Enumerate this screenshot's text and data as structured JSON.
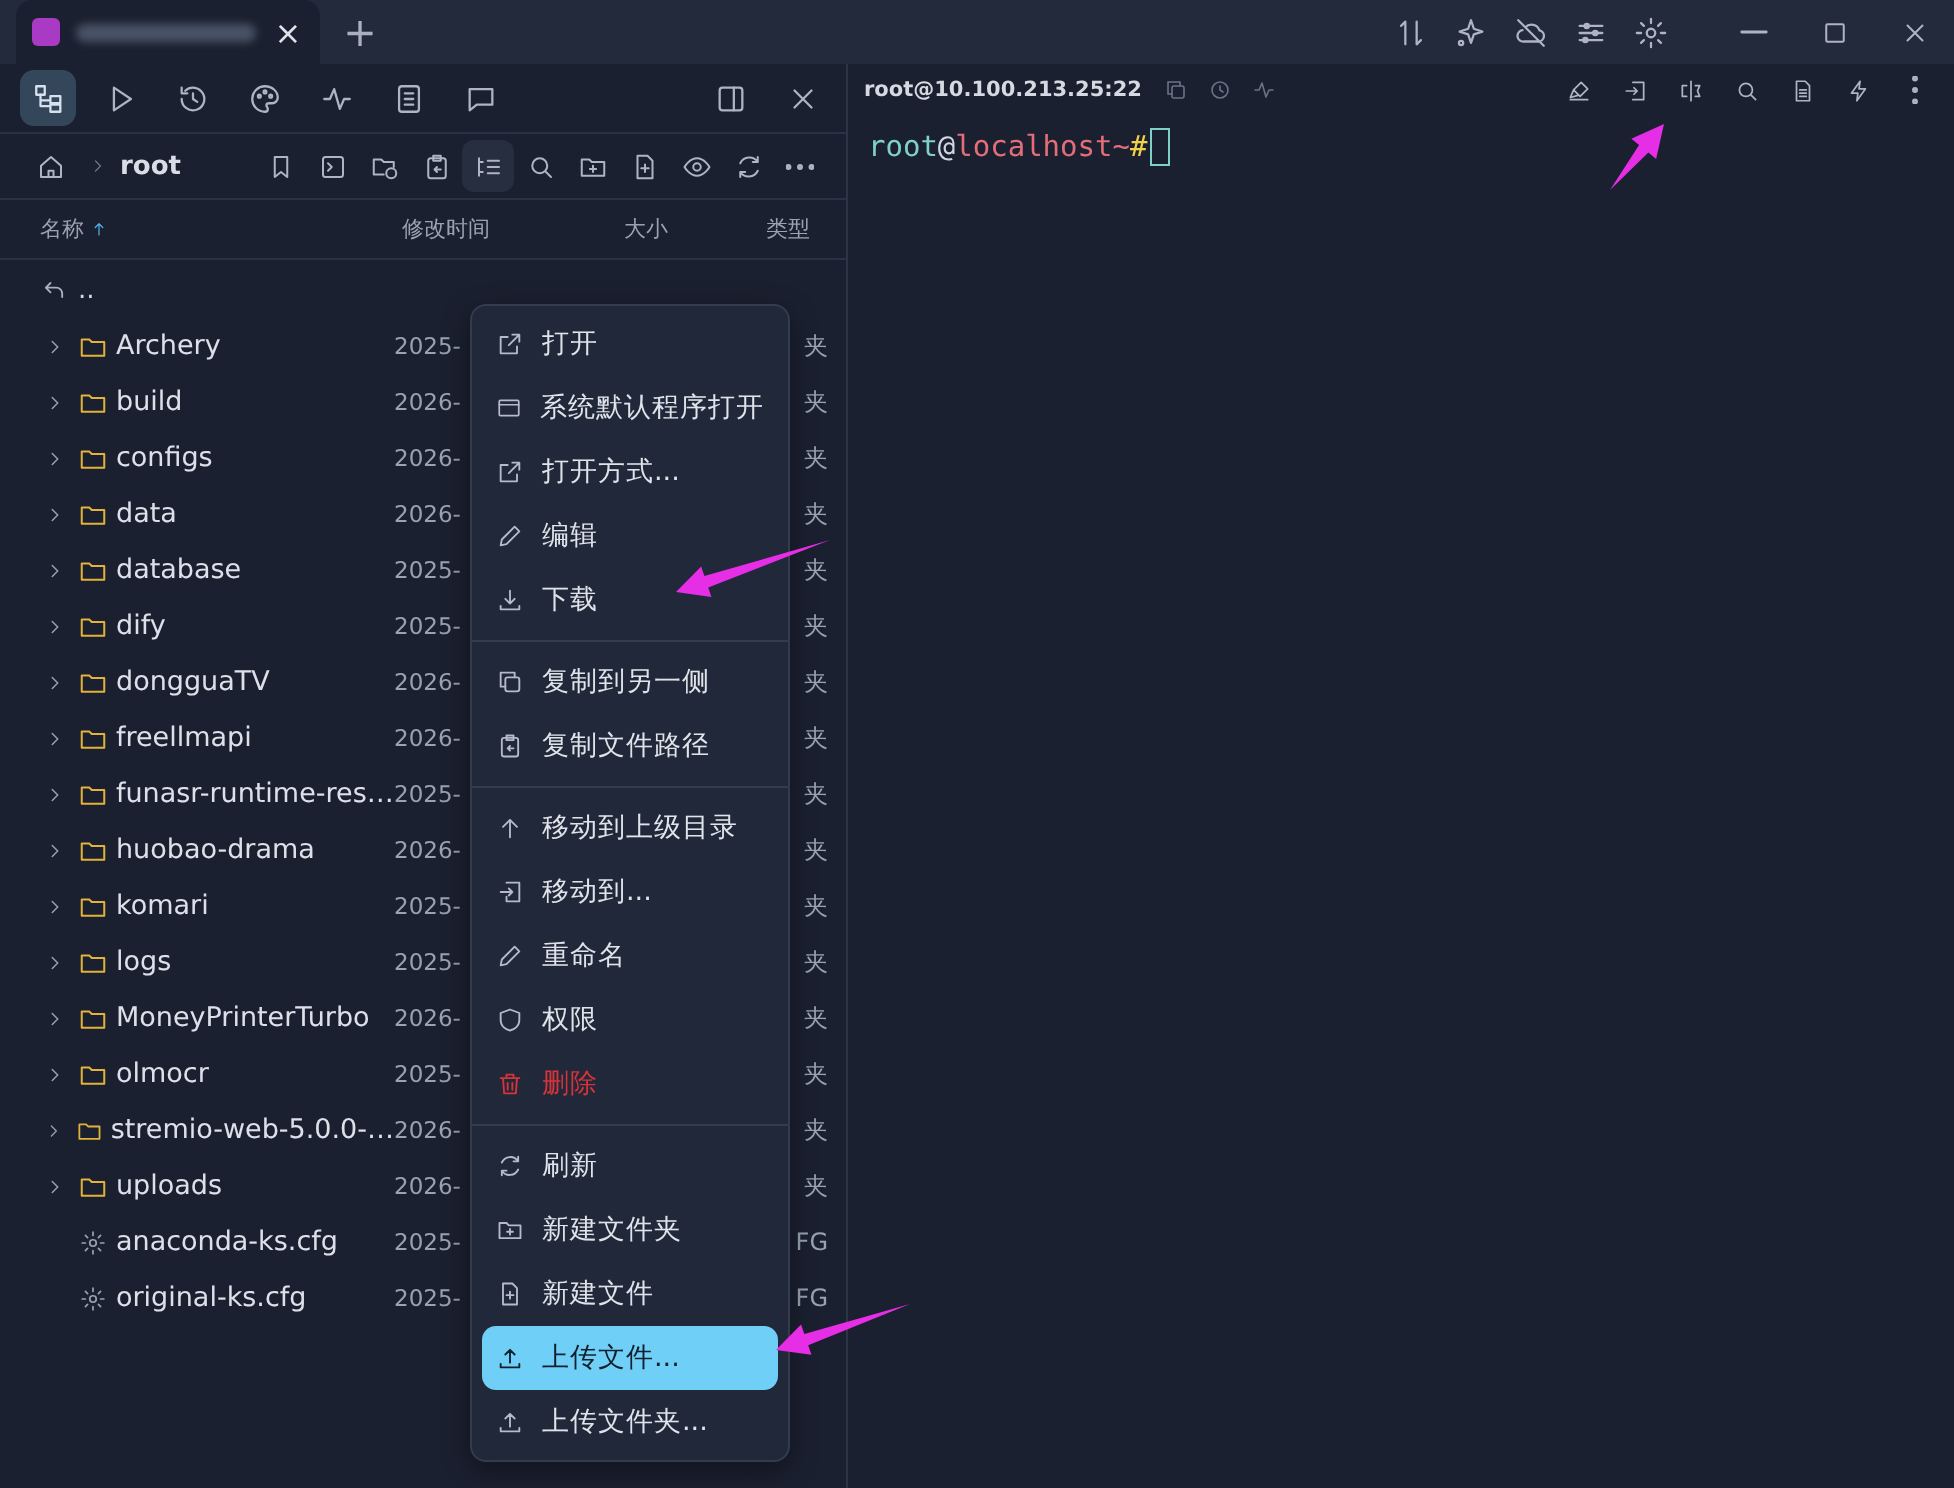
{
  "title_bar": {
    "tab": {
      "close": "×"
    },
    "new_tab": "+"
  },
  "sidebar_tabs": [
    {
      "selected": true
    },
    {
      "selected": false
    },
    {
      "selected": false
    },
    {
      "selected": false
    },
    {
      "selected": false
    },
    {
      "selected": false
    },
    {
      "selected": false
    }
  ],
  "breadcrumb": {
    "path": "root"
  },
  "table": {
    "columns": [
      {
        "label": "名称",
        "sorted": true
      },
      {
        "label": "修改时间",
        "sorted": false
      },
      {
        "label": "大小",
        "sorted": false
      },
      {
        "label": "类型",
        "sorted": false
      }
    ],
    "parent_row": "..",
    "rows": [
      {
        "kind": "folder",
        "name": "Archery",
        "modified": "2025-",
        "type": "夹"
      },
      {
        "kind": "folder",
        "name": "build",
        "modified": "2026-",
        "type": "夹"
      },
      {
        "kind": "folder",
        "name": "configs",
        "modified": "2026-",
        "type": "夹"
      },
      {
        "kind": "folder",
        "name": "data",
        "modified": "2026-",
        "type": "夹"
      },
      {
        "kind": "folder",
        "name": "database",
        "modified": "2025-",
        "type": "夹"
      },
      {
        "kind": "folder",
        "name": "dify",
        "modified": "2025-",
        "type": "夹"
      },
      {
        "kind": "folder",
        "name": "dongguaTV",
        "modified": "2026-",
        "type": "夹"
      },
      {
        "kind": "folder",
        "name": "freellmapi",
        "modified": "2026-",
        "type": "夹"
      },
      {
        "kind": "folder",
        "name": "funasr-runtime-res…",
        "modified": "2025-",
        "type": "夹"
      },
      {
        "kind": "folder",
        "name": "huobao-drama",
        "modified": "2026-",
        "type": "夹"
      },
      {
        "kind": "folder",
        "name": "komari",
        "modified": "2025-",
        "type": "夹"
      },
      {
        "kind": "folder",
        "name": "logs",
        "modified": "2025-",
        "type": "夹"
      },
      {
        "kind": "folder",
        "name": "MoneyPrinterTurbo",
        "modified": "2026-",
        "type": "夹"
      },
      {
        "kind": "folder",
        "name": "olmocr",
        "modified": "2025-",
        "type": "夹"
      },
      {
        "kind": "folder",
        "name": "stremio-web-5.0.0-…",
        "modified": "2026-",
        "type": "夹"
      },
      {
        "kind": "folder",
        "name": "uploads",
        "modified": "2026-",
        "type": "夹"
      },
      {
        "kind": "file",
        "name": "anaconda-ks.cfg",
        "modified": "2025-",
        "type": "FG"
      },
      {
        "kind": "file",
        "name": "original-ks.cfg",
        "modified": "2025-",
        "type": "FG"
      }
    ]
  },
  "context_menu": {
    "groups": [
      [
        {
          "label": "打开",
          "selected": false,
          "danger": false
        },
        {
          "label": "系统默认程序打开",
          "selected": false,
          "danger": false
        },
        {
          "label": "打开方式...",
          "selected": false,
          "danger": false
        },
        {
          "label": "编辑",
          "selected": false,
          "danger": false
        },
        {
          "label": "下载",
          "selected": false,
          "danger": false
        }
      ],
      [
        {
          "label": "复制到另一侧",
          "selected": false,
          "danger": false
        },
        {
          "label": "复制文件路径",
          "selected": false,
          "danger": false
        }
      ],
      [
        {
          "label": "移动到上级目录",
          "selected": false,
          "danger": false
        },
        {
          "label": "移动到...",
          "selected": false,
          "danger": false
        },
        {
          "label": "重命名",
          "selected": false,
          "danger": false
        },
        {
          "label": "权限",
          "selected": false,
          "danger": false
        },
        {
          "label": "删除",
          "selected": false,
          "danger": true
        }
      ],
      [
        {
          "label": "刷新",
          "selected": false,
          "danger": false
        },
        {
          "label": "新建文件夹",
          "selected": false,
          "danger": false
        },
        {
          "label": "新建文件",
          "selected": false,
          "danger": false
        },
        {
          "label": "上传文件...",
          "selected": true,
          "danger": false
        },
        {
          "label": "上传文件夹...",
          "selected": false,
          "danger": false
        }
      ]
    ]
  },
  "terminal": {
    "title": "root@10.100.213.25:22",
    "prompt": {
      "user": "root",
      "at": "@",
      "host": "localhost",
      "path": "~",
      "symbol": "#"
    }
  }
}
